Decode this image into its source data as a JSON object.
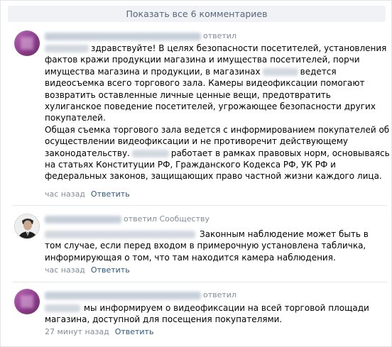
{
  "show_all_label": "Показать все 6 комментариев",
  "comments": [
    {
      "replied_label": "ответил",
      "lines": [
        "здравствуйте! В целях безопасности посетителей, установления",
        "фактов кражи продукции магазина и имущества посетителей, порчи",
        "имущества магазина и продукции, в магазинах",
        "ведется",
        "видеосъемка всего торгового зала. Камеры видеофиксации помогают",
        "возвратить оставленные личные ценные вещи, предотвратить",
        "хулиганское поведение посетителей, угрожающее безопасности других",
        "покупателей.",
        "Общая съемка торгового зала ведется с информированием покупателей об",
        "осуществлении видеофиксации и не противоречит действующему",
        "законодательству.",
        "работает в рамках правовых норм, основываясь",
        "на статьях Конституции РФ, Гражданского Кодекса РФ, УК РФ и",
        "федеральных законов, защищающих право частной жизни каждого лица."
      ],
      "time": "час назад",
      "reply": "Ответить"
    },
    {
      "replied_label": "ответил Сообществу",
      "lines": [
        "Законным наблюдение может быть в",
        "том случае, если перед входом в примерочную установлена табличка,",
        "информирующая о том, что там находится камера наблюдения."
      ],
      "time": "час назад",
      "reply": "Ответить"
    },
    {
      "replied_label": "ответил",
      "lines": [
        "мы информируем о видеофиксации на всей торговой площади",
        "магазина, доступной для посещения покупателями."
      ],
      "time": "27 минут назад",
      "reply": "Ответить"
    }
  ]
}
